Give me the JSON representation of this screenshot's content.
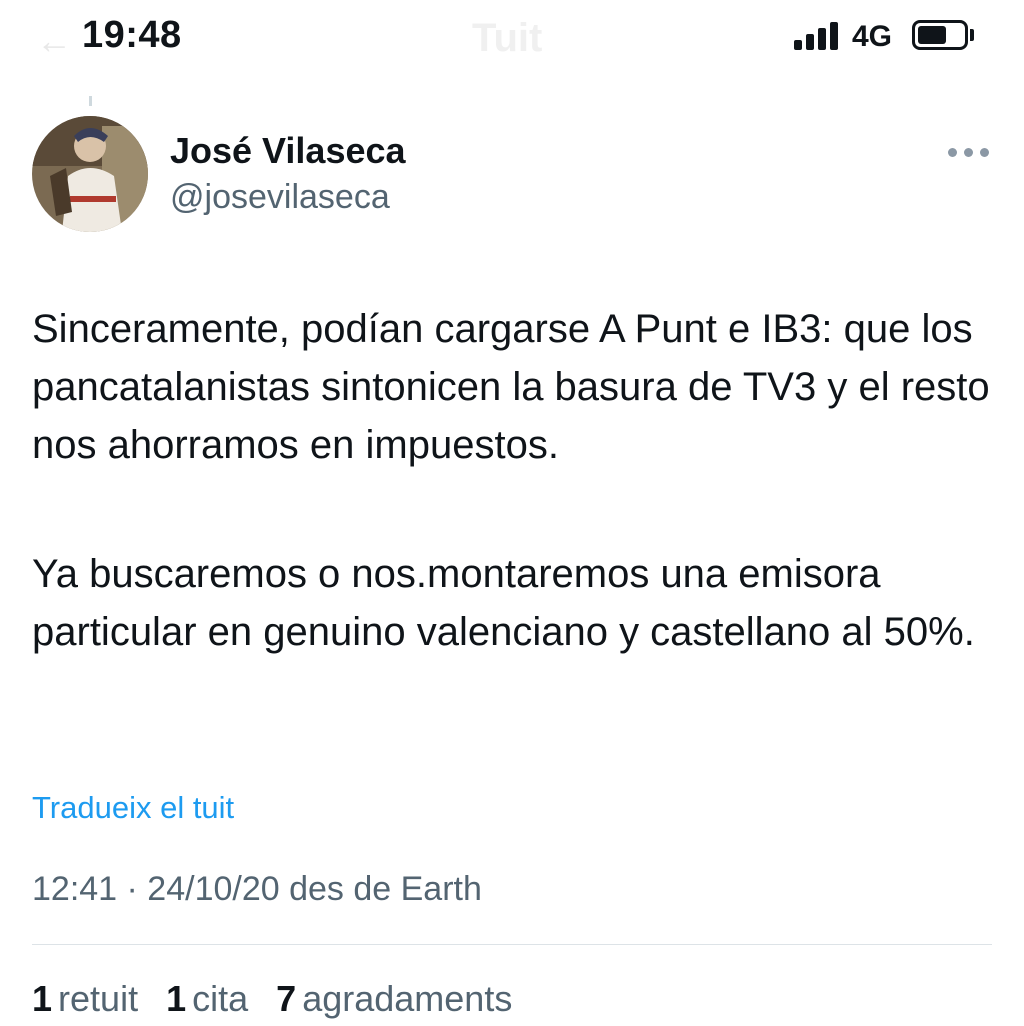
{
  "status_bar": {
    "time": "19:48",
    "network": "4G",
    "header_title": "Tuit"
  },
  "tweet": {
    "author": {
      "name": "José Vilaseca",
      "handle": "@josevilaseca"
    },
    "paragraphs": [
      "Sinceramente, podían cargarse A Punt e IB3: que los pancatalanistas sintonicen la basura de TV3 y el resto nos ahorramos en impuestos.",
      "Ya buscaremos o nos.montaremos una emisora particular en genuino valenciano y castellano al 50%."
    ],
    "translate_label": "Tradueix el tuit",
    "meta": "12:41 · 24/10/20 des de Earth",
    "stats": {
      "retweets": {
        "count": "1",
        "label": "retuit"
      },
      "quotes": {
        "count": "1",
        "label": "cita"
      },
      "likes": {
        "count": "7",
        "label": "agradaments"
      }
    }
  },
  "colors": {
    "link": "#1d9bf0",
    "secondary_text": "#536471",
    "primary_text": "#0f1419"
  },
  "icons": {
    "more": "more-horizontal-icon",
    "signal": "signal-icon",
    "battery": "battery-icon",
    "back": "back-arrow-icon"
  }
}
